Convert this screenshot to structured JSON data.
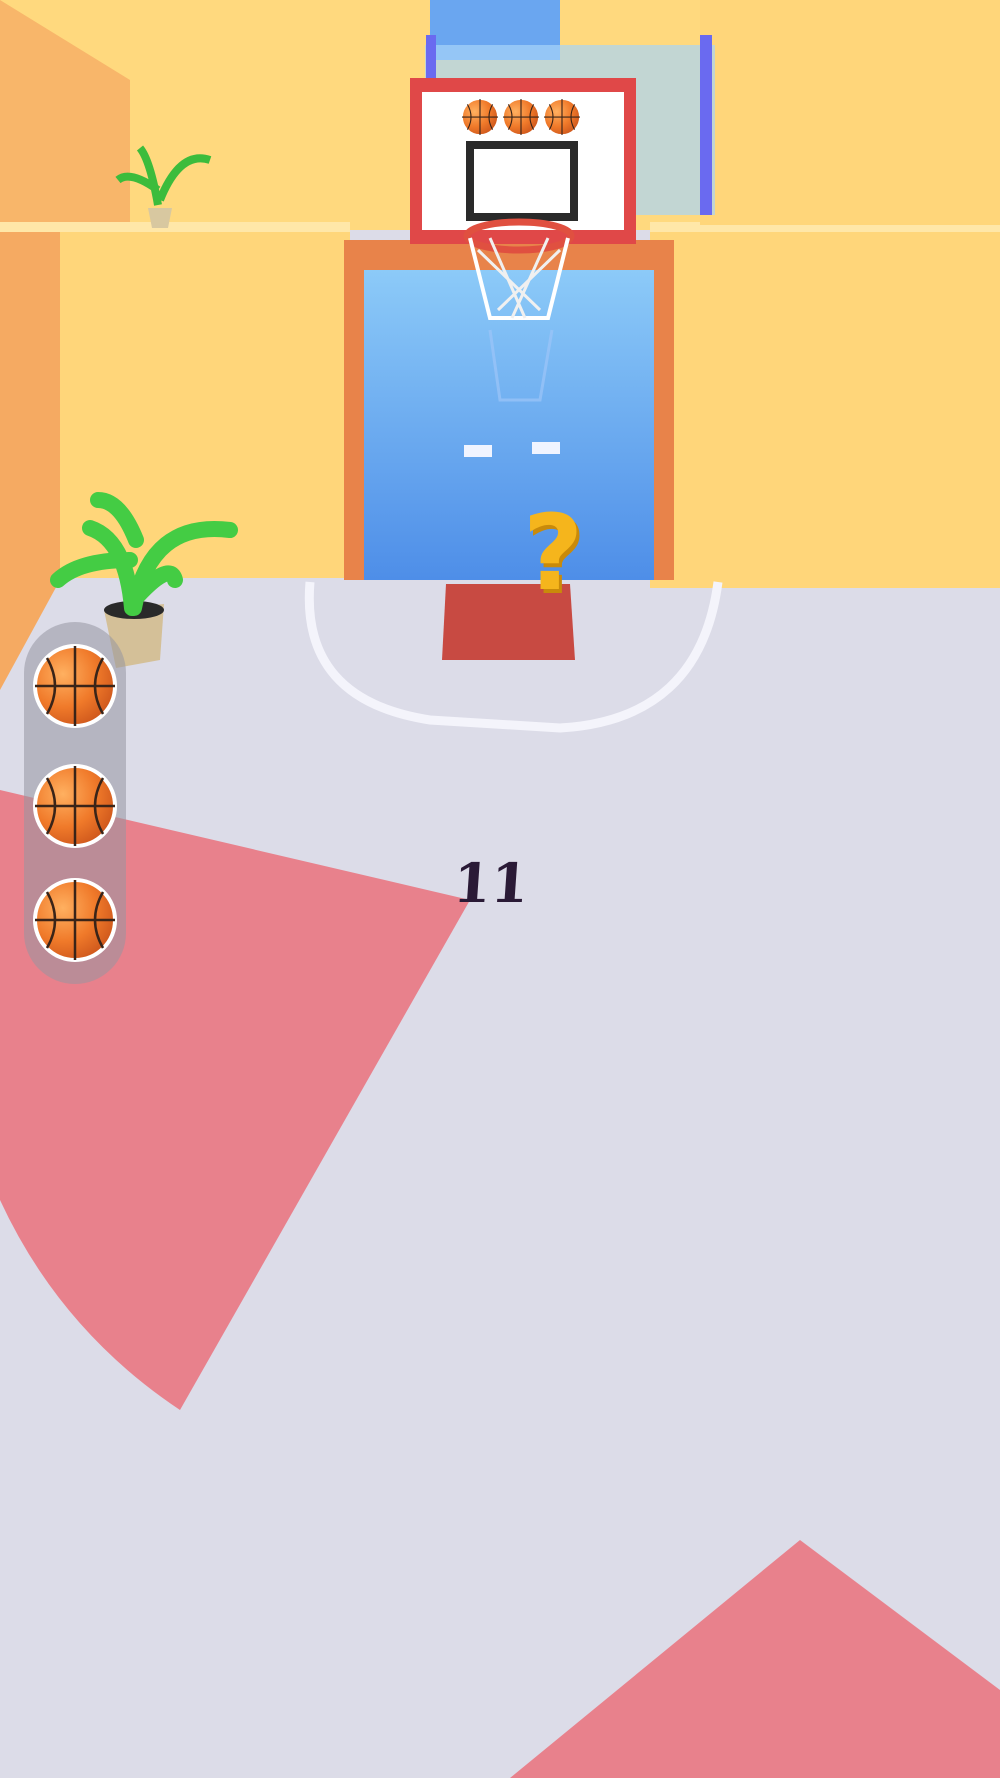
{
  "game": {
    "ball_tray": {
      "balls_remaining": 3,
      "icon": "basketball-icon"
    },
    "backboard": {
      "balls_shown": 3,
      "icon": "basketball-icon"
    },
    "hint_marker": "?",
    "player": {
      "jersey_number": "11"
    }
  },
  "colors": {
    "court_floor": "#dcdce8",
    "court_paint": "#e8818c",
    "wall": "#ffd67a",
    "lane": "#5ea0f0",
    "ball": "#f07a2a",
    "defender": "#f2505e",
    "marker_glow": "#e6fbff",
    "question_mark": "#f5b51c"
  }
}
